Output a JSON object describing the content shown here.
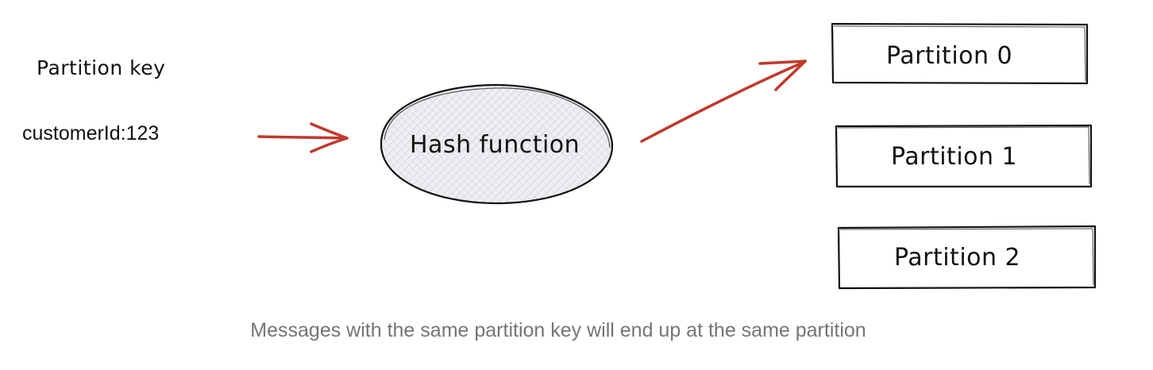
{
  "diagram": {
    "partition_key_label": "Partition key",
    "key_value": "customerId:123",
    "hash_label": "Hash function",
    "partitions": [
      {
        "label": "Partition 0"
      },
      {
        "label": "Partition 1"
      },
      {
        "label": "Partition 2"
      }
    ],
    "caption": "Messages with the same partition key will end up at the same partition"
  },
  "colors": {
    "arrow": "#c0392b",
    "ink": "#111111",
    "caption": "#757575",
    "ellipse_fill": "#e6e7ea"
  }
}
